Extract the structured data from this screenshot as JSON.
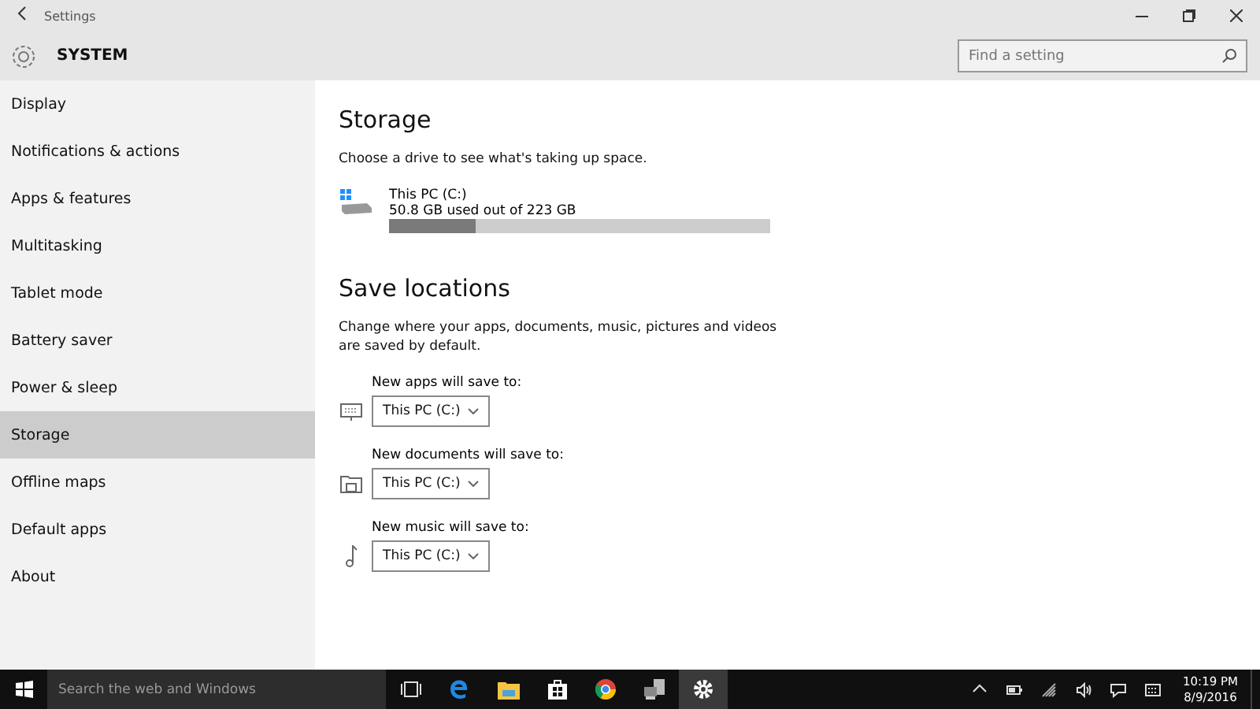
{
  "window": {
    "title": "Settings"
  },
  "header": {
    "title": "SYSTEM",
    "search": {
      "placeholder": "Find a setting"
    }
  },
  "sidebar": {
    "items": [
      {
        "label": "Display",
        "selected": false
      },
      {
        "label": "Notifications & actions",
        "selected": false
      },
      {
        "label": "Apps & features",
        "selected": false
      },
      {
        "label": "Multitasking",
        "selected": false
      },
      {
        "label": "Tablet mode",
        "selected": false
      },
      {
        "label": "Battery saver",
        "selected": false
      },
      {
        "label": "Power & sleep",
        "selected": false
      },
      {
        "label": "Storage",
        "selected": true
      },
      {
        "label": "Offline maps",
        "selected": false
      },
      {
        "label": "Default apps",
        "selected": false
      },
      {
        "label": "About",
        "selected": false
      }
    ]
  },
  "content": {
    "title": "Storage",
    "intro": "Choose a drive to see what's taking up space.",
    "drives": [
      {
        "name": "This PC (C:)",
        "usage": "50.8 GB used out of 223 GB",
        "level": 0.228
      }
    ],
    "save_title": "Save locations",
    "save_intro": "Change where your apps, documents, music, pictures and videos are saved by default.",
    "locations": [
      {
        "kind": "apps",
        "label": "New apps will save to:",
        "value": "This PC (C:)"
      },
      {
        "kind": "documents",
        "label": "New documents will save to:",
        "value": "This PC (C:)"
      },
      {
        "kind": "music",
        "label": "New music will save to:",
        "value": "This PC (C:)"
      }
    ]
  },
  "taskbar": {
    "search": {
      "placeholder": "Search the web and Windows"
    },
    "apps": [
      {
        "kind": "taskview",
        "selected": false
      },
      {
        "kind": "edge",
        "selected": false
      },
      {
        "kind": "explorer",
        "selected": false
      },
      {
        "kind": "store",
        "selected": false
      },
      {
        "kind": "chrome",
        "selected": false
      },
      {
        "kind": "computer",
        "selected": false
      },
      {
        "kind": "settings",
        "selected": true
      }
    ],
    "time": "10:19 PM",
    "date": "8/9/2016"
  }
}
